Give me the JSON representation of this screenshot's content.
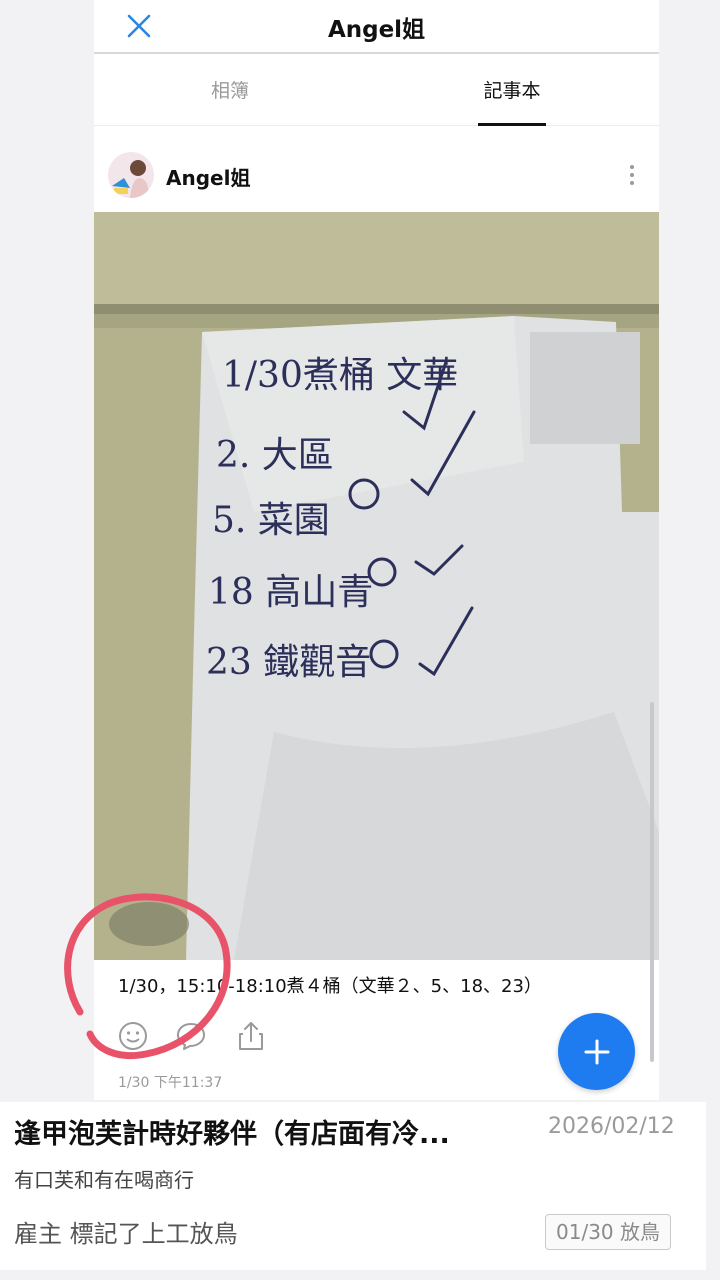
{
  "header": {
    "title": "Angel姐"
  },
  "tabs": [
    {
      "label": "相簿"
    },
    {
      "label": "記事本"
    }
  ],
  "post": {
    "author": "Angel姐",
    "caption": "1/30，15:10-18:10煮４桶（文華２、5、18、23）",
    "timestamp": "1/30 下午11:37",
    "note_lines": [
      "1/30煮桶 文華",
      "2. 大區",
      "5. 菜園",
      "18 高山青",
      "23 鐵觀音"
    ]
  },
  "card": {
    "title": "逢甲泡芙計時好夥伴（有店面有冷...",
    "date": "2026/02/12",
    "subtitle": "有口芙和有在喝商行",
    "status": "雇主 標記了上工放鳥",
    "badge": "01/30 放鳥"
  },
  "colors": {
    "accent": "#1e7bf0",
    "annotation": "#e8536a"
  }
}
